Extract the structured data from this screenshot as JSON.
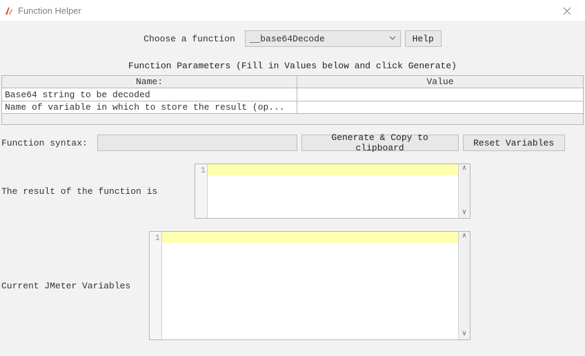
{
  "titlebar": {
    "title": "Function Helper"
  },
  "choose": {
    "label": "Choose a function ",
    "selected": "__base64Decode",
    "help": "Help"
  },
  "params": {
    "heading": "Function Parameters (Fill in Values below and click Generate)",
    "col_name": "Name:",
    "col_value": "Value",
    "rows": [
      {
        "name": "Base64 string to be decoded",
        "value": ""
      },
      {
        "name": "Name of variable in which to store the result (op...",
        "value": ""
      }
    ]
  },
  "syntax": {
    "label": "Function syntax: ",
    "value": "",
    "generate": "Generate & Copy to clipboard",
    "reset": "Reset Variables"
  },
  "result": {
    "label": "The result of the function is ",
    "gutter": "1",
    "value": ""
  },
  "vars": {
    "label": "Current JMeter Variables ",
    "gutter": "1",
    "value": ""
  }
}
